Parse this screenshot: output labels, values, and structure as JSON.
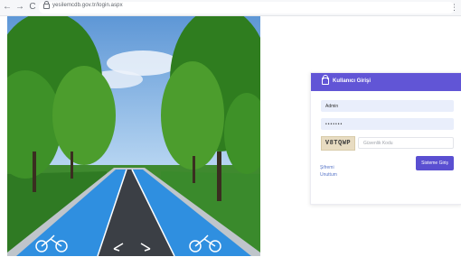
{
  "browser": {
    "url": "yesilemcdb.gov.tr/login.aspx",
    "back_icon": "←",
    "forward_icon": "→",
    "reload_icon": "C",
    "menu_icon": "⋮"
  },
  "login": {
    "title": "Kullanıcı Girişi",
    "username_value": "Admin",
    "password_value": "•••••••",
    "captcha_text": "V8TQWP",
    "captcha_placeholder": "Güvenlik Kodu",
    "forgot_line1": "Şifremi",
    "forgot_line2": "Unuttum",
    "submit_label": "Sisteme Giriş"
  },
  "colors": {
    "header": "#6155d6",
    "button": "#5a4fd1",
    "field": "#e9eefb",
    "bike_lane": "#2f8fe0"
  }
}
